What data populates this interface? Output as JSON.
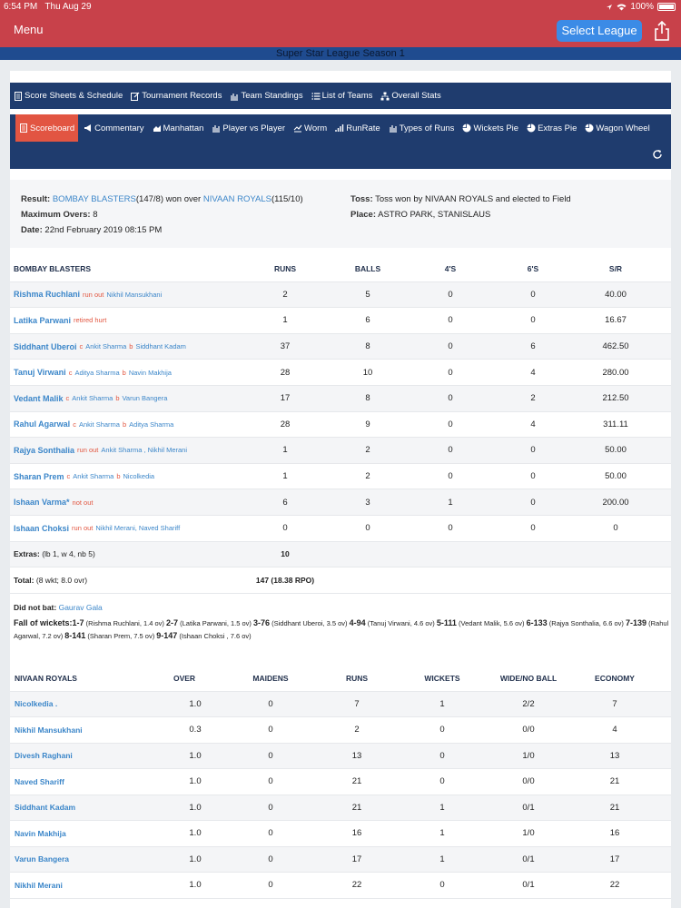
{
  "status": {
    "time": "6:54 PM",
    "date": "Thu Aug 29",
    "battery": "100%"
  },
  "nav": {
    "menu": "Menu",
    "select_league": "Select League"
  },
  "league_title": "Super Star League Season 1",
  "top_nav": [
    "Score Sheets & Schedule",
    "Tournament Records",
    "Team Standings",
    "List of Teams",
    "Overall Stats"
  ],
  "sub_nav": [
    "Scoreboard",
    "Commentary",
    "Manhattan",
    "Player vs Player",
    "Worm",
    "RunRate",
    "Types of Runs",
    "Wickets Pie",
    "Extras Pie",
    "Wagon Wheel"
  ],
  "match": {
    "result_label": "Result:",
    "team1": "BOMBAY BLASTERS",
    "team1_score": "(147/8) won over",
    "team2": "NIVAAN ROYALS",
    "team2_score": "(115/10)",
    "max_overs_label": "Maximum Overs:",
    "max_overs": "8",
    "date_label": "Date:",
    "date": "22nd February 2019 08:15 PM",
    "toss_label": "Toss:",
    "toss": "Toss won by NIVAAN ROYALS and elected to Field",
    "place_label": "Place:",
    "place": "ASTRO PARK, STANISLAUS"
  },
  "batting": {
    "team": "BOMBAY BLASTERS",
    "headers": [
      "RUNS",
      "BALLS",
      "4'S",
      "6'S",
      "S/R"
    ],
    "rows": [
      {
        "name": "Rishma Ruchlani",
        "d1": "run out",
        "d2": "Nikhil Mansukhani",
        "d3": "",
        "d4": "",
        "runs": "2",
        "balls": "5",
        "fours": "0",
        "sixes": "0",
        "sr": "40.00"
      },
      {
        "name": "Latika Parwani",
        "d1": "retired hurt",
        "d2": "",
        "d3": "",
        "d4": "",
        "runs": "1",
        "balls": "6",
        "fours": "0",
        "sixes": "0",
        "sr": "16.67"
      },
      {
        "name": "Siddhant Uberoi",
        "d1": "c",
        "d2": "Ankit Sharma",
        "d3": "b",
        "d4": "Siddhant Kadam",
        "runs": "37",
        "balls": "8",
        "fours": "0",
        "sixes": "6",
        "sr": "462.50"
      },
      {
        "name": "Tanuj Virwani",
        "d1": "c",
        "d2": "Aditya Sharma",
        "d3": "b",
        "d4": "Navin Makhija",
        "runs": "28",
        "balls": "10",
        "fours": "0",
        "sixes": "4",
        "sr": "280.00"
      },
      {
        "name": "Vedant Malik",
        "d1": "c",
        "d2": "Ankit Sharma",
        "d3": "b",
        "d4": "Varun Bangera",
        "runs": "17",
        "balls": "8",
        "fours": "0",
        "sixes": "2",
        "sr": "212.50"
      },
      {
        "name": "Rahul Agarwal",
        "d1": "c",
        "d2": "Ankit Sharma",
        "d3": "b",
        "d4": "Aditya Sharma",
        "runs": "28",
        "balls": "9",
        "fours": "0",
        "sixes": "4",
        "sr": "311.11"
      },
      {
        "name": "Rajya Sonthalia",
        "d1": "run out",
        "d2": "Ankit Sharma , Nikhil Merani",
        "d3": "",
        "d4": "",
        "runs": "1",
        "balls": "2",
        "fours": "0",
        "sixes": "0",
        "sr": "50.00"
      },
      {
        "name": "Sharan Prem",
        "d1": "c",
        "d2": "Ankit Sharma",
        "d3": "b",
        "d4": "Nicolkedia",
        "runs": "1",
        "balls": "2",
        "fours": "0",
        "sixes": "0",
        "sr": "50.00"
      },
      {
        "name": "Ishaan Varma*",
        "d1": "not out",
        "d2": "",
        "d3": "",
        "d4": "",
        "runs": "6",
        "balls": "3",
        "fours": "1",
        "sixes": "0",
        "sr": "200.00"
      },
      {
        "name": "Ishaan Choksi",
        "d1": "run out",
        "d2": "Nikhil Merani, Naved Shariff",
        "d3": "",
        "d4": "",
        "runs": "0",
        "balls": "0",
        "fours": "0",
        "sixes": "0",
        "sr": "0"
      }
    ],
    "extras_label": "Extras:",
    "extras_detail": "(lb 1, w 4, nb 5)",
    "extras_value": "10",
    "total_label": "Total:",
    "total_detail": "(8 wkt; 8.0 ovr)",
    "total_value": "147 (18.38 RPO)"
  },
  "did_not_bat": {
    "label": "Did not bat:",
    "players": "Gaurav Gala"
  },
  "fall_of_wickets": {
    "label": "Fall of wickets:",
    "items": [
      {
        "score": "1-7",
        "detail": "(Rishma Ruchlani, 1.4 ov)"
      },
      {
        "score": "2-7",
        "detail": "(Latika Parwani, 1.5 ov)"
      },
      {
        "score": "3-76",
        "detail": "(Siddhant Uberoi, 3.5 ov)"
      },
      {
        "score": "4-94",
        "detail": "(Tanuj Virwani, 4.6 ov)"
      },
      {
        "score": "5-111",
        "detail": "(Vedant Malik, 5.6 ov)"
      },
      {
        "score": "6-133",
        "detail": "(Rajya Sonthalia, 6.6 ov)"
      },
      {
        "score": "7-139",
        "detail": "(Rahul Agarwal, 7.2 ov)"
      },
      {
        "score": "8-141",
        "detail": "(Sharan Prem, 7.5 ov)"
      },
      {
        "score": "9-147",
        "detail": "(Ishaan Choksi , 7.6 ov)"
      }
    ]
  },
  "bowling": {
    "team": "NIVAAN ROYALS",
    "headers": [
      "OVER",
      "MAIDENS",
      "RUNS",
      "WICKETS",
      "WIDE/NO BALL",
      "ECONOMY"
    ],
    "rows": [
      {
        "name": "Nicolkedia .",
        "over": "1.0",
        "maidens": "0",
        "runs": "7",
        "wickets": "1",
        "wnb": "2/2",
        "econ": "7"
      },
      {
        "name": "Nikhil Mansukhani",
        "over": "0.3",
        "maidens": "0",
        "runs": "2",
        "wickets": "0",
        "wnb": "0/0",
        "econ": "4"
      },
      {
        "name": "Divesh Raghani",
        "over": "1.0",
        "maidens": "0",
        "runs": "13",
        "wickets": "0",
        "wnb": "1/0",
        "econ": "13"
      },
      {
        "name": "Naved Shariff",
        "over": "1.0",
        "maidens": "0",
        "runs": "21",
        "wickets": "0",
        "wnb": "0/0",
        "econ": "21"
      },
      {
        "name": "Siddhant Kadam",
        "over": "1.0",
        "maidens": "0",
        "runs": "21",
        "wickets": "1",
        "wnb": "0/1",
        "econ": "21"
      },
      {
        "name": "Navin Makhija",
        "over": "1.0",
        "maidens": "0",
        "runs": "16",
        "wickets": "1",
        "wnb": "1/0",
        "econ": "16"
      },
      {
        "name": "Varun Bangera",
        "over": "1.0",
        "maidens": "0",
        "runs": "17",
        "wickets": "1",
        "wnb": "0/1",
        "econ": "17"
      },
      {
        "name": "Nikhil Merani",
        "over": "1.0",
        "maidens": "0",
        "runs": "22",
        "wickets": "0",
        "wnb": "0/1",
        "econ": "22"
      }
    ]
  },
  "colors": {
    "brand_red": "#c8414a",
    "nav_blue": "#1f3c6e",
    "accent_blue": "#3b8be6",
    "active_tab": "#e25542",
    "link": "#3b86c9"
  }
}
